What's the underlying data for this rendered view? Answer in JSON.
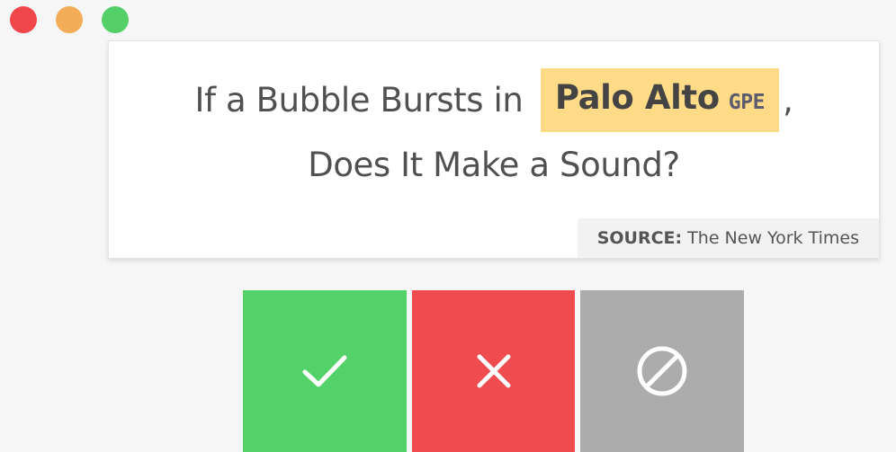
{
  "window": {
    "controls": [
      "close",
      "minimize",
      "zoom"
    ],
    "colors": {
      "close": "#f0474c",
      "minimize": "#f2ad56",
      "zoom": "#55cf68"
    }
  },
  "card": {
    "headline_before": "If a Bubble Bursts in",
    "entity_text": "Palo Alto",
    "entity_label": "GPE",
    "headline_after_comma": ",",
    "headline_line2": "Does It Make a Sound?",
    "source_label": "SOURCE:",
    "source_value": "The New York Times"
  },
  "actions": {
    "accept": {
      "icon": "checkmark-icon",
      "color": "#54d26a"
    },
    "reject": {
      "icon": "cross-icon",
      "color": "#f04c50"
    },
    "ignore": {
      "icon": "no-entry-icon",
      "color": "#acacac"
    }
  },
  "highlight_color": "#ffdb88"
}
